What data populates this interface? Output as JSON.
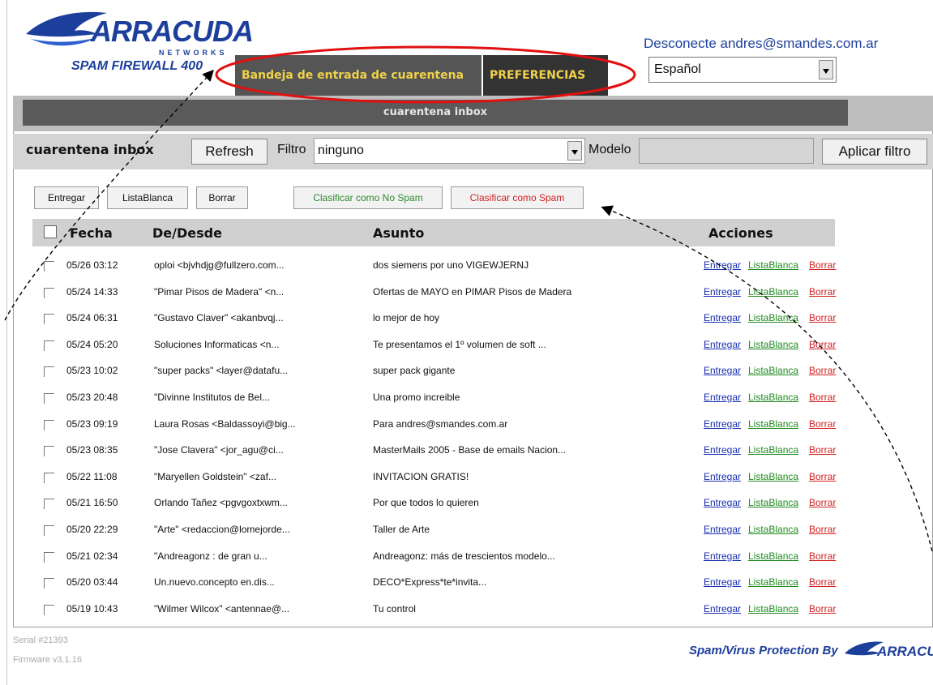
{
  "logo": {
    "word": "ARRACUDA",
    "networks": "NETWORKS",
    "product": "SPAM FIREWALL 400"
  },
  "tabs": [
    {
      "label": "Bandeja de entrada de cuarentena"
    },
    {
      "label": "PREFERENCIAS"
    }
  ],
  "header": {
    "logout": "Desconecte andres@smandes.com.ar",
    "language": "Español"
  },
  "panel": {
    "title": "cuarentena inbox"
  },
  "toolbar": {
    "label": "cuarentena inbox",
    "refresh": "Refresh",
    "filter_label": "Filtro",
    "filter_value": "ninguno",
    "model_label": "Modelo",
    "model_value": "",
    "apply": "Aplicar filtro"
  },
  "actions": {
    "deliver": "Entregar",
    "whitelist": "ListaBlanca",
    "delete": "Borrar",
    "not_spam": "Clasificar como No Spam",
    "spam": "Clasificar como Spam"
  },
  "table": {
    "headers": {
      "date": "Fecha",
      "from": "De/Desde",
      "subject": "Asunto",
      "actions": "Acciones"
    },
    "link_labels": {
      "deliver": "Entregar",
      "whitelist": "ListaBlanca",
      "delete": "Borrar"
    },
    "rows": [
      {
        "date": "05/26 03:12",
        "from": "oploi <bjvhdjg@fullzero.com...",
        "subject": "dos siemens por uno VIGEWJERNJ"
      },
      {
        "date": "05/24 14:33",
        "from": "\"Pimar Pisos de Madera\" <n...",
        "subject": "Ofertas de MAYO en PIMAR Pisos de Madera"
      },
      {
        "date": "05/24 06:31",
        "from": "\"Gustavo Claver\" <akanbvqj...",
        "subject": "lo mejor de hoy"
      },
      {
        "date": "05/24 05:20",
        "from": "Soluciones Informaticas <n...",
        "subject": "Te presentamos el 1º volumen de soft ..."
      },
      {
        "date": "05/23 10:02",
        "from": "\"super packs\" <layer@datafu...",
        "subject": "super pack gigante"
      },
      {
        "date": "05/23 20:48",
        "from": "\"Divinne Institutos de Bel...",
        "subject": "Una promo increible"
      },
      {
        "date": "05/23 09:19",
        "from": "Laura Rosas <Baldassoyi@big...",
        "subject": "Para andres@smandes.com.ar"
      },
      {
        "date": "05/23 08:35",
        "from": "\"Jose Clavera\" <jor_agu@ci...",
        "subject": "MasterMails 2005 - Base de emails Nacion..."
      },
      {
        "date": "05/22 11:08",
        "from": "\"Maryellen Goldstein\" <zaf...",
        "subject": "INVITACION GRATIS!"
      },
      {
        "date": "05/21 16:50",
        "from": "Orlando Tañez <pgvgoxtxwm...",
        "subject": "Por que todos lo quieren"
      },
      {
        "date": "05/20 22:29",
        "from": "\"Arte\" <redaccion@lomejorde...",
        "subject": "Taller de Arte"
      },
      {
        "date": "05/21 02:34",
        "from": "\"Andreagonz : de gran u...",
        "subject": "Andreagonz: más de trescientos modelo..."
      },
      {
        "date": "05/20 03:44",
        "from": "Un.nuevo.concepto en.dis...",
        "subject": "DECO*Express*te*invita..."
      },
      {
        "date": "05/19 10:43",
        "from": "\"Wilmer Wilcox\" <antennae@...",
        "subject": "Tu control"
      }
    ]
  },
  "footer": {
    "serial": "Serial #21393",
    "firmware": "Firmware v3.1.16",
    "protection": "Spam/Virus Protection By",
    "logo_word": "ARRACUDA"
  },
  "colors": {
    "brand": "#1d3f9c",
    "tab_text": "#f0d24a",
    "deliver_link": "#1a2fb0",
    "whitelist_link": "#1f8a1f",
    "delete_link": "#d42020",
    "annotation": "#e01010"
  }
}
